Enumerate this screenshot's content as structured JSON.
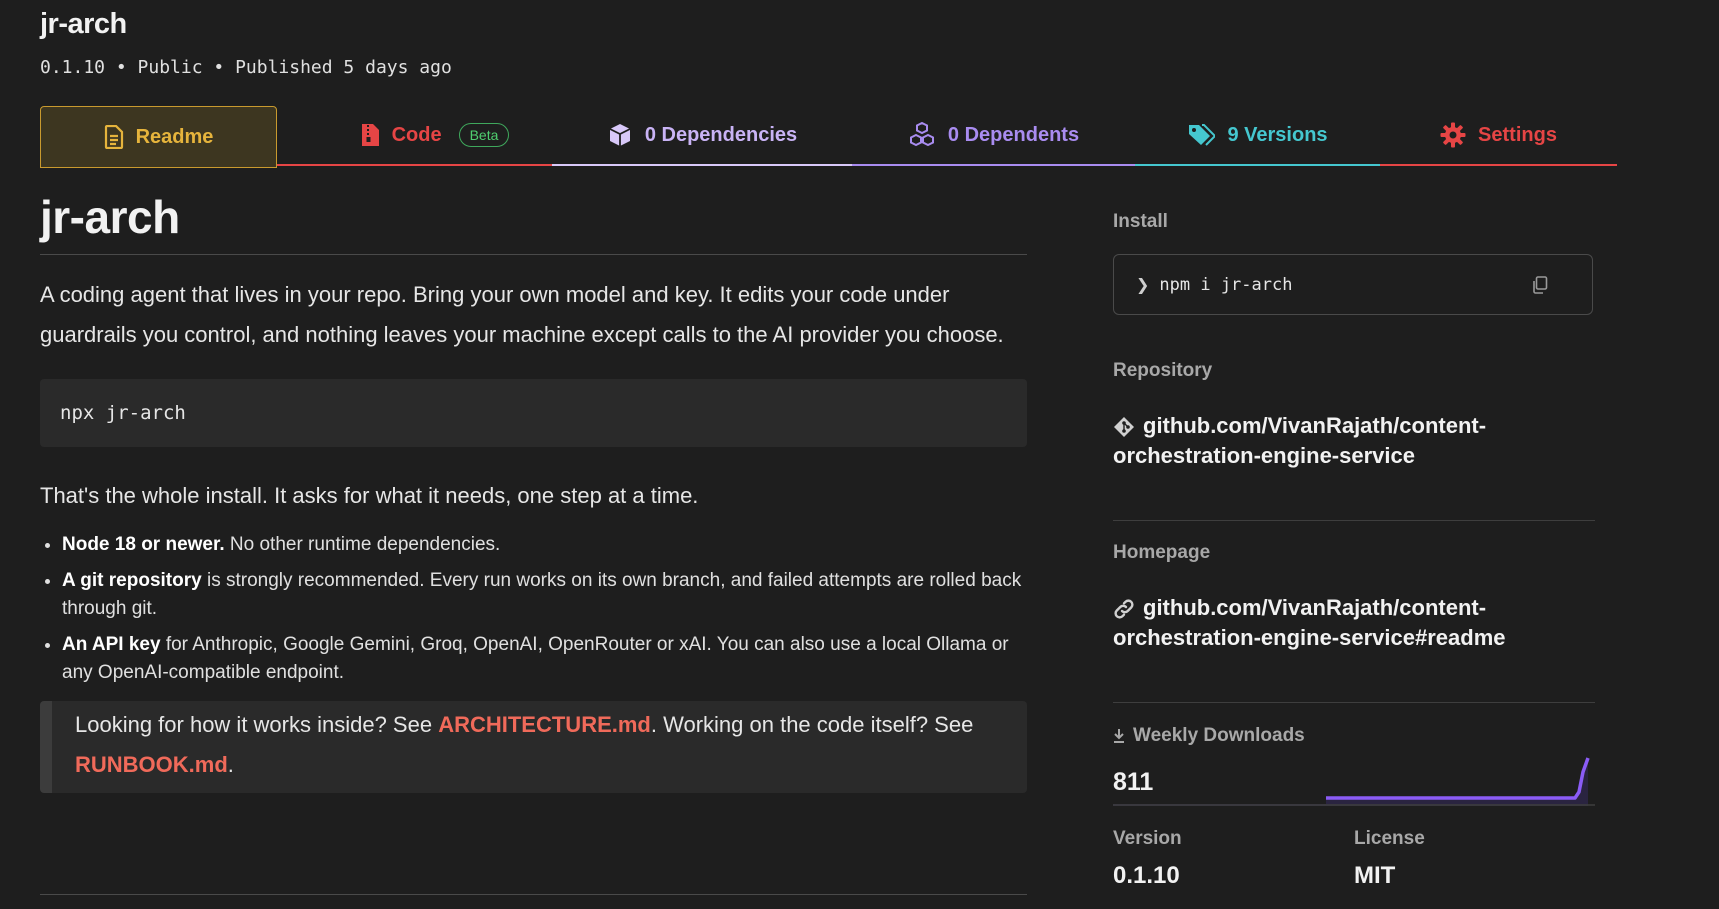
{
  "package": {
    "name": "jr-arch",
    "meta": "0.1.10 • Public • Published 5 days ago"
  },
  "tabs": [
    {
      "label": "Readme",
      "icon": "document-icon",
      "color": "#e6b43c",
      "active": true
    },
    {
      "label": "Code",
      "icon": "zip-file-icon",
      "color": "#e64545",
      "badge": "Beta"
    },
    {
      "label": "0 Dependencies",
      "icon": "box-icon",
      "color": "#c9b3f5"
    },
    {
      "label": "0 Dependents",
      "icon": "boxes-icon",
      "color": "#a98cf0"
    },
    {
      "label": "9 Versions",
      "icon": "tags-icon",
      "color": "#45c7cf"
    },
    {
      "label": "Settings",
      "icon": "gear-icon",
      "color": "#e64545"
    }
  ],
  "readme": {
    "title": "jr-arch",
    "lead": "A coding agent that lives in your repo. Bring your own model and key. It edits your code under guardrails you control, and nothing leaves your machine except calls to the AI provider you choose.",
    "code": "npx jr-arch",
    "install_note": "That's the whole install. It asks for what it needs, one step at a time.",
    "requirements": [
      {
        "bold": "Node 18 or newer.",
        "text": " No other runtime dependencies."
      },
      {
        "bold": "A git repository",
        "text": " is strongly recommended. Every run works on its own branch, and failed attempts are rolled back through git."
      },
      {
        "bold": "An API key",
        "text": " for Anthropic, Google Gemini, Groq, OpenAI, OpenRouter or xAI. You can also use a local Ollama or any OpenAI-compatible endpoint."
      }
    ],
    "callout": {
      "before": "Looking for how it works inside? See ",
      "link1": "ARCHITECTURE.md",
      "middle": ". Working on the code itself? See ",
      "link2": "RUNBOOK.md",
      "after": "."
    }
  },
  "sidebar": {
    "install_label": "Install",
    "install_prompt": "❯",
    "install_cmd": "npm i jr-arch",
    "repository_label": "Repository",
    "repository_url": "github.com/VivanRajath/content-orchestration-engine-service",
    "homepage_label": "Homepage",
    "homepage_url": "github.com/VivanRajath/content-orchestration-engine-service#readme",
    "downloads_label": "Weekly Downloads",
    "downloads_value": "811",
    "version_label": "Version",
    "version_value": "0.1.10",
    "license_label": "License",
    "license_value": "MIT"
  },
  "colors": {
    "accent_readme": "#e6b43c",
    "link": "#f06a5a",
    "sparkline": "#8b5cf6"
  }
}
